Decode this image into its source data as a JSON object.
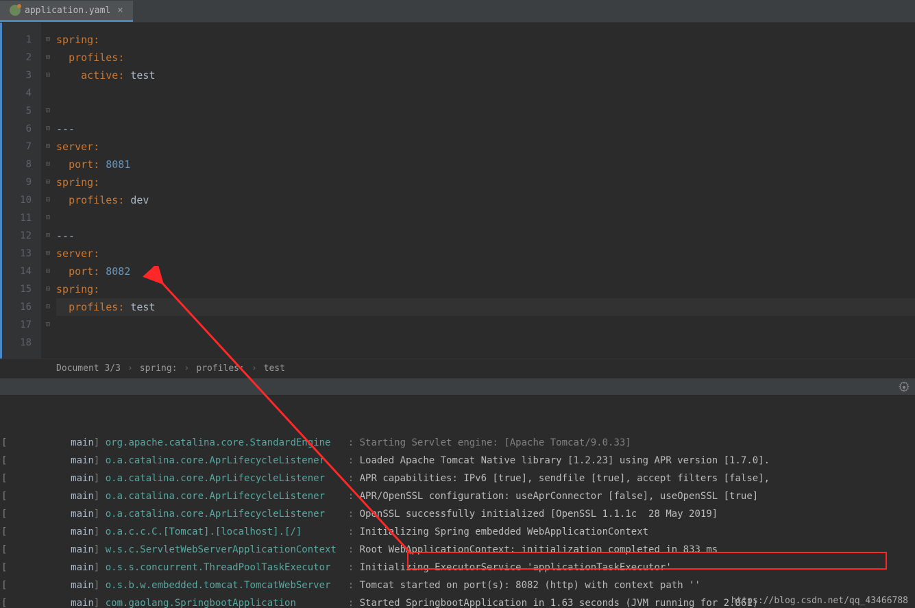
{
  "tab": {
    "label": "application.yaml",
    "close": "×"
  },
  "gutter": [
    "1",
    "2",
    "3",
    "4",
    "5",
    "6",
    "7",
    "8",
    "9",
    "10",
    "11",
    "12",
    "13",
    "14",
    "15",
    "16",
    "17",
    "18"
  ],
  "code": [
    {
      "tokens": [
        {
          "c": "kw",
          "t": "spring"
        },
        {
          "c": "punct",
          "t": ":"
        }
      ]
    },
    {
      "tokens": [
        {
          "c": "",
          "t": "  "
        },
        {
          "c": "kw",
          "t": "profiles"
        },
        {
          "c": "punct",
          "t": ":"
        }
      ]
    },
    {
      "tokens": [
        {
          "c": "",
          "t": "    "
        },
        {
          "c": "kw",
          "t": "active"
        },
        {
          "c": "punct",
          "t": ":"
        },
        {
          "c": "",
          "t": " "
        },
        {
          "c": "val",
          "t": "test"
        }
      ]
    },
    {
      "tokens": []
    },
    {
      "tokens": []
    },
    {
      "tokens": [
        {
          "c": "val",
          "t": "---"
        }
      ]
    },
    {
      "tokens": [
        {
          "c": "kw",
          "t": "server"
        },
        {
          "c": "punct",
          "t": ":"
        }
      ]
    },
    {
      "tokens": [
        {
          "c": "",
          "t": "  "
        },
        {
          "c": "kw",
          "t": "port"
        },
        {
          "c": "punct",
          "t": ":"
        },
        {
          "c": "",
          "t": " "
        },
        {
          "c": "num",
          "t": "8081"
        }
      ]
    },
    {
      "tokens": [
        {
          "c": "kw",
          "t": "spring"
        },
        {
          "c": "punct",
          "t": ":"
        }
      ]
    },
    {
      "tokens": [
        {
          "c": "",
          "t": "  "
        },
        {
          "c": "kw",
          "t": "profiles"
        },
        {
          "c": "punct",
          "t": ":"
        },
        {
          "c": "",
          "t": " "
        },
        {
          "c": "val",
          "t": "dev"
        }
      ]
    },
    {
      "tokens": []
    },
    {
      "tokens": [
        {
          "c": "val",
          "t": "---"
        }
      ]
    },
    {
      "tokens": [
        {
          "c": "kw",
          "t": "server"
        },
        {
          "c": "punct",
          "t": ":"
        }
      ]
    },
    {
      "tokens": [
        {
          "c": "",
          "t": "  "
        },
        {
          "c": "kw",
          "t": "port"
        },
        {
          "c": "punct",
          "t": ":"
        },
        {
          "c": "",
          "t": " "
        },
        {
          "c": "num",
          "t": "8082"
        }
      ]
    },
    {
      "tokens": [
        {
          "c": "kw",
          "t": "spring"
        },
        {
          "c": "punct",
          "t": ":"
        }
      ]
    },
    {
      "tokens": [
        {
          "c": "",
          "t": "  "
        },
        {
          "c": "kw",
          "t": "profiles"
        },
        {
          "c": "punct",
          "t": ":"
        },
        {
          "c": "",
          "t": " "
        },
        {
          "c": "val",
          "t": "test"
        }
      ],
      "current": true
    },
    {
      "tokens": []
    },
    {
      "tokens": []
    }
  ],
  "breadcrumb": {
    "doc": "Document 3/3",
    "p1": "spring:",
    "p2": "profiles:",
    "p3": "test"
  },
  "console": [
    {
      "thread": "main",
      "logger": "org.apache.catalina.core.StandardEngine",
      "msg": "Starting Servlet engine: [Apache Tomcat/9.0.33]",
      "dim": true
    },
    {
      "thread": "main",
      "logger": "o.a.catalina.core.AprLifecycleListener",
      "msg": "Loaded Apache Tomcat Native library [1.2.23] using APR version [1.7.0]."
    },
    {
      "thread": "main",
      "logger": "o.a.catalina.core.AprLifecycleListener",
      "msg": "APR capabilities: IPv6 [true], sendfile [true], accept filters [false],"
    },
    {
      "thread": "main",
      "logger": "o.a.catalina.core.AprLifecycleListener",
      "msg": "APR/OpenSSL configuration: useAprConnector [false], useOpenSSL [true]"
    },
    {
      "thread": "main",
      "logger": "o.a.catalina.core.AprLifecycleListener",
      "msg": "OpenSSL successfully initialized [OpenSSL 1.1.1c  28 May 2019]"
    },
    {
      "thread": "main",
      "logger": "o.a.c.c.C.[Tomcat].[localhost].[/]",
      "msg": "Initializing Spring embedded WebApplicationContext"
    },
    {
      "thread": "main",
      "logger": "w.s.c.ServletWebServerApplicationContext",
      "msg": "Root WebApplicationContext: initialization completed in 833 ms"
    },
    {
      "thread": "main",
      "logger": "o.s.s.concurrent.ThreadPoolTaskExecutor",
      "msg": "Initializing ExecutorService 'applicationTaskExecutor'"
    },
    {
      "thread": "main",
      "logger": "o.s.b.w.embedded.tomcat.TomcatWebServer",
      "msg": "Tomcat started on port(s): 8082 (http) with context path ''"
    },
    {
      "thread": "main",
      "logger": "com.gaolang.SpringbootApplication",
      "msg": "Started SpringbootApplication in 1.63 seconds (JVM running for 2.861)"
    }
  ],
  "watermark": "https://blog.csdn.net/qq_43466788"
}
